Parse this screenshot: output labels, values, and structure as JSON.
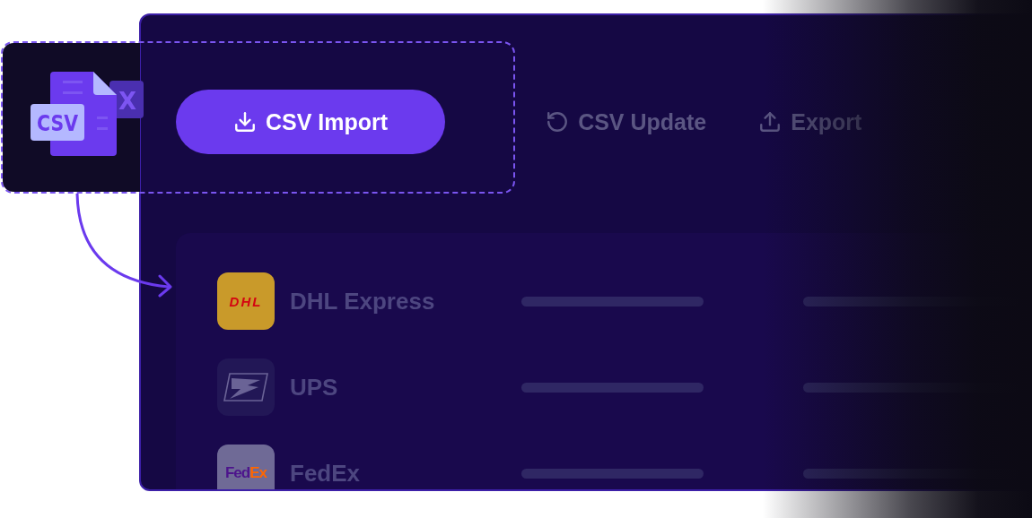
{
  "file_icon": {
    "badge": "CSV",
    "letter": "X"
  },
  "toolbar": [
    {
      "label": "CSV Import",
      "kind": "download",
      "selected": true
    },
    {
      "label": "CSV Update",
      "kind": "rotate",
      "selected": false
    },
    {
      "label": "Export",
      "kind": "upload",
      "selected": false
    }
  ],
  "carriers": [
    {
      "name": "DHL Express",
      "kind": "dhl",
      "logo_parts": [
        {
          "text": "DHL",
          "color": "#d40511"
        }
      ]
    },
    {
      "name": "UPS",
      "kind": "eagle"
    },
    {
      "name": "FedEx",
      "kind": "fedex",
      "logo_parts": [
        {
          "text": "Fed",
          "color": "#4d148c"
        },
        {
          "text": "Ex",
          "color": "#ff6600"
        }
      ]
    }
  ]
}
